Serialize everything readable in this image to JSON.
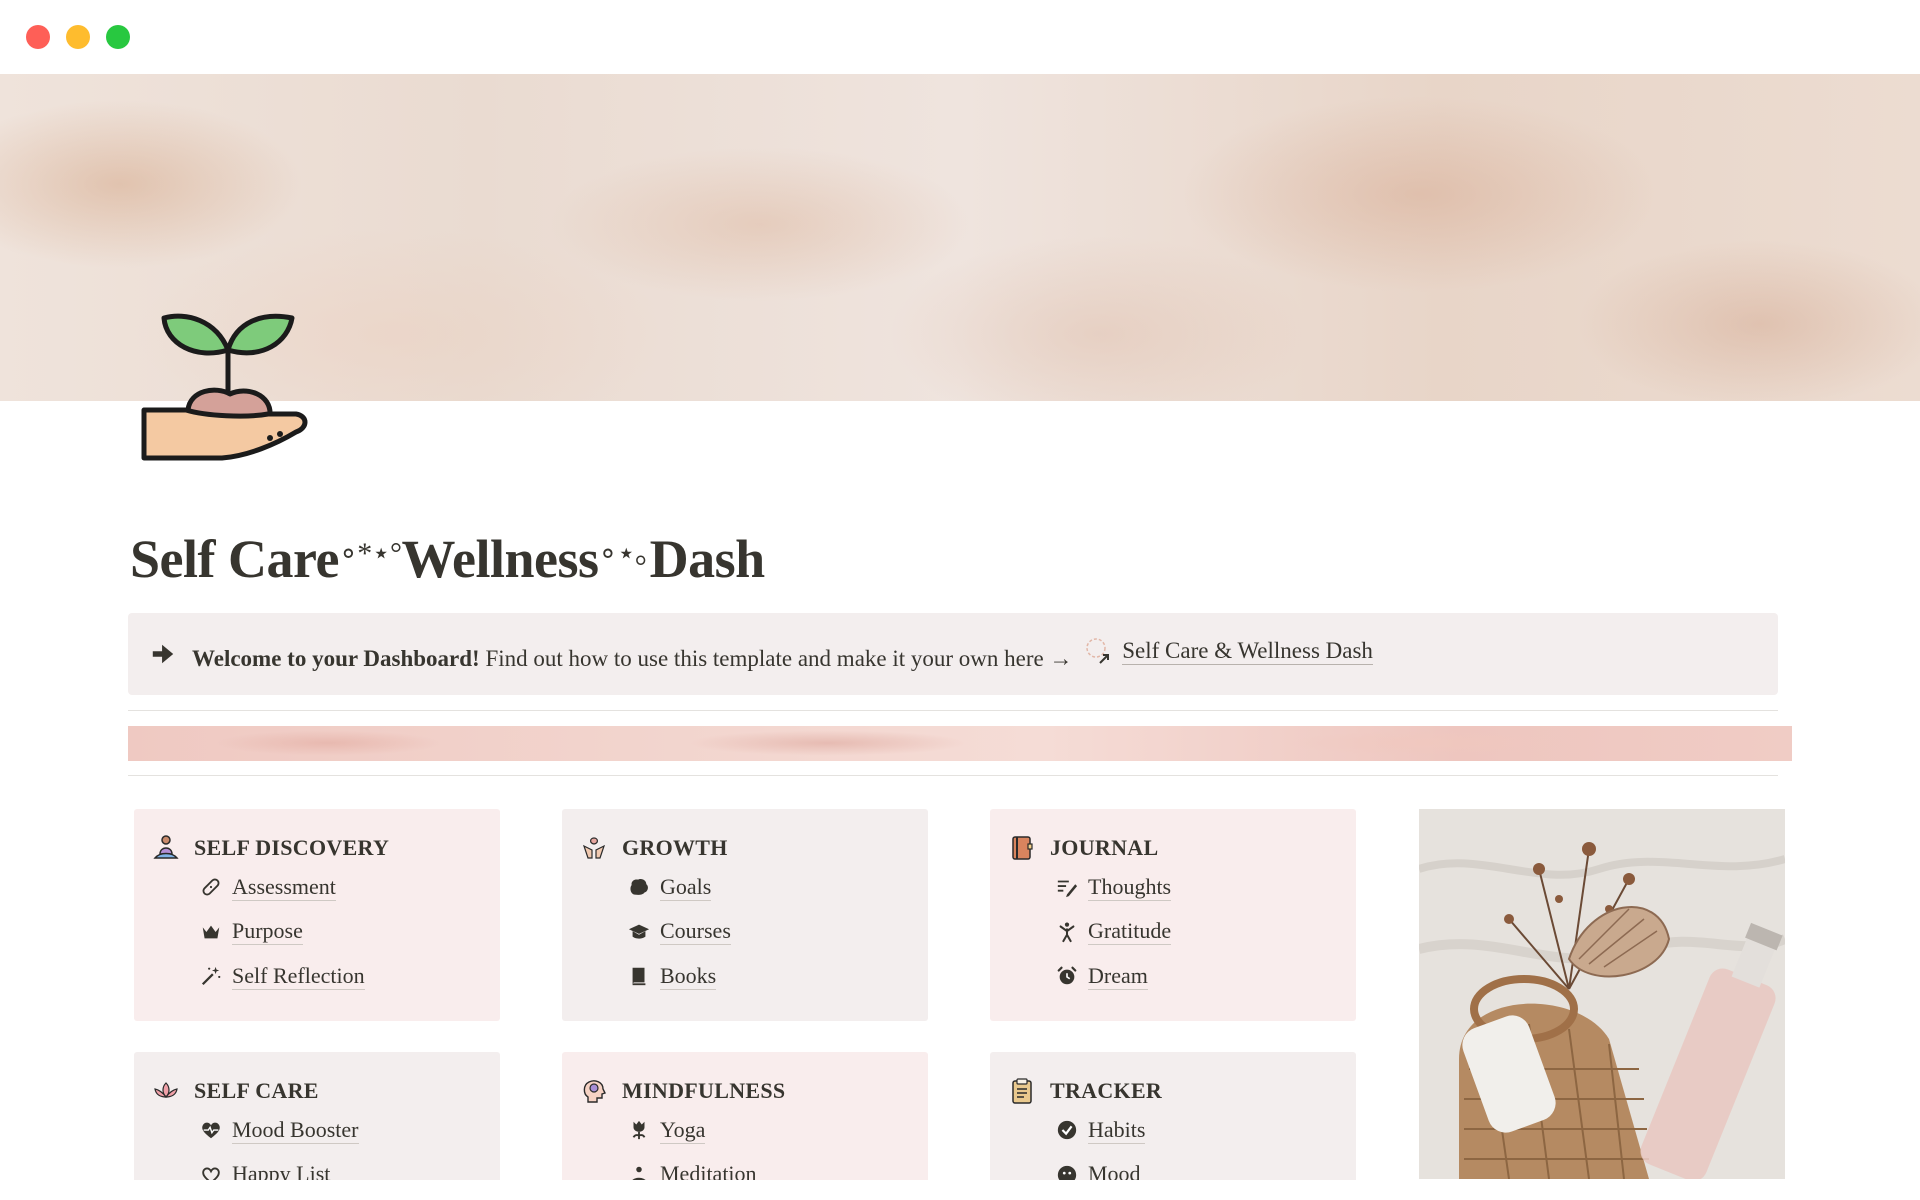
{
  "window": {
    "controls": [
      "close",
      "minimize",
      "zoom"
    ]
  },
  "page": {
    "icon": "seedling-in-hand-icon",
    "title_part1": "Self Care",
    "title_sparkle1": "∘*⋆°",
    "title_part2": "Wellness",
    "title_sparkle2": "∘⋆｡",
    "title_part3": "Dash"
  },
  "callout": {
    "icon": "arrow-right-icon",
    "bold_text": "Welcome to your Dashboard!",
    "text": " Find out how to use this template and make it your own here →",
    "link_label": "Self Care & Wellness Dash"
  },
  "cards": [
    {
      "title": "SELF DISCOVERY",
      "icon": "meditating-person-icon",
      "items": [
        {
          "label": "Assessment",
          "icon": "bandage-icon"
        },
        {
          "label": "Purpose",
          "icon": "crown-icon"
        },
        {
          "label": "Self Reflection",
          "icon": "magic-wand-icon"
        }
      ]
    },
    {
      "title": "GROWTH",
      "icon": "hands-plant-icon",
      "items": [
        {
          "label": "Goals",
          "icon": "brain-icon"
        },
        {
          "label": "Courses",
          "icon": "graduation-cap-icon"
        },
        {
          "label": "Books",
          "icon": "book-icon"
        }
      ]
    },
    {
      "title": "JOURNAL",
      "icon": "journal-icon",
      "items": [
        {
          "label": "Thoughts",
          "icon": "write-lines-icon"
        },
        {
          "label": "Gratitude",
          "icon": "person-arms-up-icon"
        },
        {
          "label": "Dream",
          "icon": "alarm-clock-icon"
        }
      ]
    },
    {
      "title": "SELF CARE",
      "icon": "lotus-icon",
      "items": [
        {
          "label": "Mood Booster",
          "icon": "heart-pulse-icon"
        },
        {
          "label": "Happy List",
          "icon": "heart-outline-icon"
        }
      ]
    },
    {
      "title": "MINDFULNESS",
      "icon": "mind-head-icon",
      "items": [
        {
          "label": "Yoga",
          "icon": "tulip-icon"
        },
        {
          "label": "Meditation",
          "icon": "meditation-icon"
        }
      ]
    },
    {
      "title": "TRACKER",
      "icon": "clipboard-icon",
      "items": [
        {
          "label": "Habits",
          "icon": "check-circle-icon"
        },
        {
          "label": "Mood",
          "icon": "face-icon"
        }
      ]
    }
  ],
  "colors": {
    "text": "#37352f",
    "callout_bg": "#f3eeee",
    "card_pink": "#f9eded",
    "card_grey": "#f3eeee",
    "icon_green": "#7ecb7b",
    "icon_skin": "#f4c9a2",
    "icon_soil": "#d4a199"
  }
}
